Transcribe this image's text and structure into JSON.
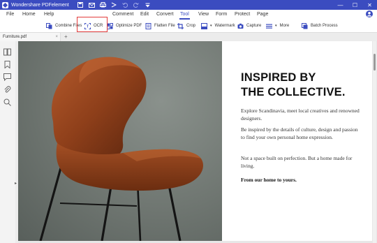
{
  "app": {
    "title": "Wondershare PDFelement",
    "window_controls": {
      "minimize": "—",
      "maximize": "☐",
      "close": "✕"
    }
  },
  "menu": {
    "items": [
      {
        "label": "File",
        "active": false
      },
      {
        "label": "Home",
        "active": false
      },
      {
        "label": "Help",
        "active": false
      },
      {
        "label": "Comment",
        "active": false
      },
      {
        "label": "Edit",
        "active": false
      },
      {
        "label": "Convert",
        "active": false
      },
      {
        "label": "Tool",
        "active": true
      },
      {
        "label": "View",
        "active": false
      },
      {
        "label": "Form",
        "active": false
      },
      {
        "label": "Protect",
        "active": false
      },
      {
        "label": "Page",
        "active": false
      }
    ]
  },
  "toolbar": {
    "combine": "Combine Files",
    "ocr": "OCR",
    "optimize": "Optimize PDF",
    "flatten": "Flatten File",
    "crop": "Crop",
    "watermark": "Watermark",
    "capture": "Capture",
    "more": "More",
    "batch": "Batch Process"
  },
  "tabs": {
    "file": "Furniture.pdf",
    "close": "×",
    "new": "+"
  },
  "document": {
    "headline_1": "INSPIRED BY",
    "headline_2": "THE COLLECTIVE.",
    "para_1": "Explore Scandinavia, meet local creatives and renowned designers.",
    "para_2": "Be inspired by the details of culture, design and passion to find your own personal home expression.",
    "para_3": "Not a space built on perfection. But a home made for living.",
    "para_4": "From our home to yours."
  },
  "colors": {
    "accent": "#3b4cc0",
    "highlight": "#e33b3b"
  }
}
